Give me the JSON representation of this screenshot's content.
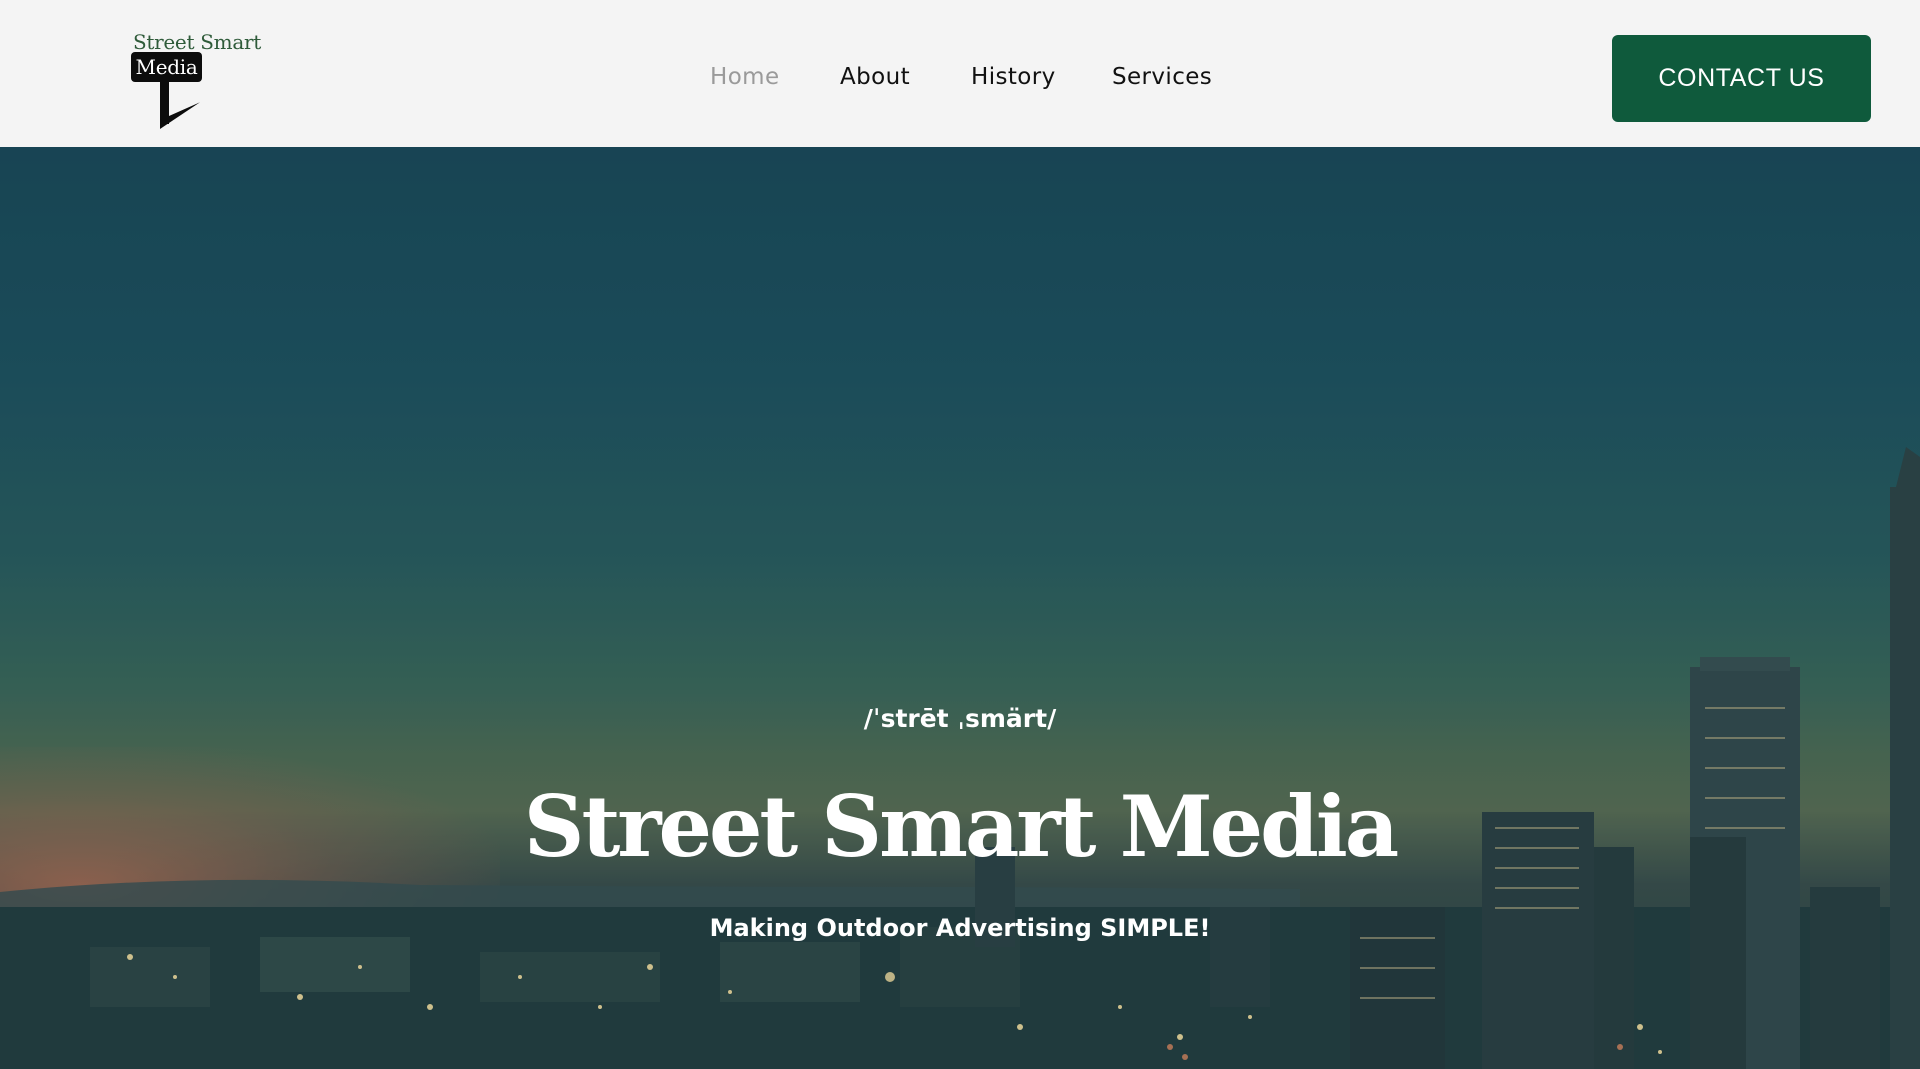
{
  "header": {
    "logo": {
      "line1": "Street Smart",
      "line2": "Media"
    },
    "nav": [
      {
        "label": "Home",
        "active": true
      },
      {
        "label": "About",
        "active": false
      },
      {
        "label": "History",
        "active": false
      },
      {
        "label": "Services",
        "active": false
      }
    ],
    "contact_label": "CONTACT US"
  },
  "hero": {
    "pronunciation": "/ˈstrēt ˌsmärt/",
    "title": "Street Smart Media",
    "tagline": "Making Outdoor Advertising SIMPLE!"
  },
  "colors": {
    "brand_green": "#0f5a3c",
    "nav_active": "#9a9a9a",
    "header_bg": "#f4f4f4"
  }
}
